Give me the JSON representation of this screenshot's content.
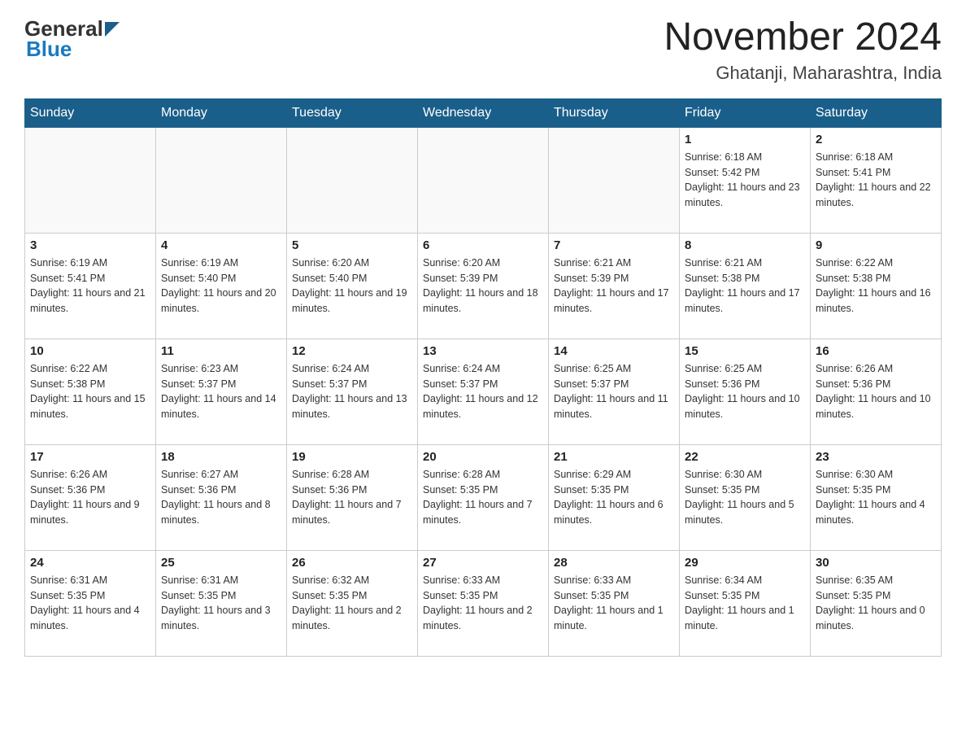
{
  "header": {
    "logo_general": "General",
    "logo_blue": "Blue",
    "month_title": "November 2024",
    "location": "Ghatanji, Maharashtra, India"
  },
  "days_of_week": [
    "Sunday",
    "Monday",
    "Tuesday",
    "Wednesday",
    "Thursday",
    "Friday",
    "Saturday"
  ],
  "weeks": [
    [
      {
        "day": "",
        "sunrise": "",
        "sunset": "",
        "daylight": ""
      },
      {
        "day": "",
        "sunrise": "",
        "sunset": "",
        "daylight": ""
      },
      {
        "day": "",
        "sunrise": "",
        "sunset": "",
        "daylight": ""
      },
      {
        "day": "",
        "sunrise": "",
        "sunset": "",
        "daylight": ""
      },
      {
        "day": "",
        "sunrise": "",
        "sunset": "",
        "daylight": ""
      },
      {
        "day": "1",
        "sunrise": "Sunrise: 6:18 AM",
        "sunset": "Sunset: 5:42 PM",
        "daylight": "Daylight: 11 hours and 23 minutes."
      },
      {
        "day": "2",
        "sunrise": "Sunrise: 6:18 AM",
        "sunset": "Sunset: 5:41 PM",
        "daylight": "Daylight: 11 hours and 22 minutes."
      }
    ],
    [
      {
        "day": "3",
        "sunrise": "Sunrise: 6:19 AM",
        "sunset": "Sunset: 5:41 PM",
        "daylight": "Daylight: 11 hours and 21 minutes."
      },
      {
        "day": "4",
        "sunrise": "Sunrise: 6:19 AM",
        "sunset": "Sunset: 5:40 PM",
        "daylight": "Daylight: 11 hours and 20 minutes."
      },
      {
        "day": "5",
        "sunrise": "Sunrise: 6:20 AM",
        "sunset": "Sunset: 5:40 PM",
        "daylight": "Daylight: 11 hours and 19 minutes."
      },
      {
        "day": "6",
        "sunrise": "Sunrise: 6:20 AM",
        "sunset": "Sunset: 5:39 PM",
        "daylight": "Daylight: 11 hours and 18 minutes."
      },
      {
        "day": "7",
        "sunrise": "Sunrise: 6:21 AM",
        "sunset": "Sunset: 5:39 PM",
        "daylight": "Daylight: 11 hours and 17 minutes."
      },
      {
        "day": "8",
        "sunrise": "Sunrise: 6:21 AM",
        "sunset": "Sunset: 5:38 PM",
        "daylight": "Daylight: 11 hours and 17 minutes."
      },
      {
        "day": "9",
        "sunrise": "Sunrise: 6:22 AM",
        "sunset": "Sunset: 5:38 PM",
        "daylight": "Daylight: 11 hours and 16 minutes."
      }
    ],
    [
      {
        "day": "10",
        "sunrise": "Sunrise: 6:22 AM",
        "sunset": "Sunset: 5:38 PM",
        "daylight": "Daylight: 11 hours and 15 minutes."
      },
      {
        "day": "11",
        "sunrise": "Sunrise: 6:23 AM",
        "sunset": "Sunset: 5:37 PM",
        "daylight": "Daylight: 11 hours and 14 minutes."
      },
      {
        "day": "12",
        "sunrise": "Sunrise: 6:24 AM",
        "sunset": "Sunset: 5:37 PM",
        "daylight": "Daylight: 11 hours and 13 minutes."
      },
      {
        "day": "13",
        "sunrise": "Sunrise: 6:24 AM",
        "sunset": "Sunset: 5:37 PM",
        "daylight": "Daylight: 11 hours and 12 minutes."
      },
      {
        "day": "14",
        "sunrise": "Sunrise: 6:25 AM",
        "sunset": "Sunset: 5:37 PM",
        "daylight": "Daylight: 11 hours and 11 minutes."
      },
      {
        "day": "15",
        "sunrise": "Sunrise: 6:25 AM",
        "sunset": "Sunset: 5:36 PM",
        "daylight": "Daylight: 11 hours and 10 minutes."
      },
      {
        "day": "16",
        "sunrise": "Sunrise: 6:26 AM",
        "sunset": "Sunset: 5:36 PM",
        "daylight": "Daylight: 11 hours and 10 minutes."
      }
    ],
    [
      {
        "day": "17",
        "sunrise": "Sunrise: 6:26 AM",
        "sunset": "Sunset: 5:36 PM",
        "daylight": "Daylight: 11 hours and 9 minutes."
      },
      {
        "day": "18",
        "sunrise": "Sunrise: 6:27 AM",
        "sunset": "Sunset: 5:36 PM",
        "daylight": "Daylight: 11 hours and 8 minutes."
      },
      {
        "day": "19",
        "sunrise": "Sunrise: 6:28 AM",
        "sunset": "Sunset: 5:36 PM",
        "daylight": "Daylight: 11 hours and 7 minutes."
      },
      {
        "day": "20",
        "sunrise": "Sunrise: 6:28 AM",
        "sunset": "Sunset: 5:35 PM",
        "daylight": "Daylight: 11 hours and 7 minutes."
      },
      {
        "day": "21",
        "sunrise": "Sunrise: 6:29 AM",
        "sunset": "Sunset: 5:35 PM",
        "daylight": "Daylight: 11 hours and 6 minutes."
      },
      {
        "day": "22",
        "sunrise": "Sunrise: 6:30 AM",
        "sunset": "Sunset: 5:35 PM",
        "daylight": "Daylight: 11 hours and 5 minutes."
      },
      {
        "day": "23",
        "sunrise": "Sunrise: 6:30 AM",
        "sunset": "Sunset: 5:35 PM",
        "daylight": "Daylight: 11 hours and 4 minutes."
      }
    ],
    [
      {
        "day": "24",
        "sunrise": "Sunrise: 6:31 AM",
        "sunset": "Sunset: 5:35 PM",
        "daylight": "Daylight: 11 hours and 4 minutes."
      },
      {
        "day": "25",
        "sunrise": "Sunrise: 6:31 AM",
        "sunset": "Sunset: 5:35 PM",
        "daylight": "Daylight: 11 hours and 3 minutes."
      },
      {
        "day": "26",
        "sunrise": "Sunrise: 6:32 AM",
        "sunset": "Sunset: 5:35 PM",
        "daylight": "Daylight: 11 hours and 2 minutes."
      },
      {
        "day": "27",
        "sunrise": "Sunrise: 6:33 AM",
        "sunset": "Sunset: 5:35 PM",
        "daylight": "Daylight: 11 hours and 2 minutes."
      },
      {
        "day": "28",
        "sunrise": "Sunrise: 6:33 AM",
        "sunset": "Sunset: 5:35 PM",
        "daylight": "Daylight: 11 hours and 1 minute."
      },
      {
        "day": "29",
        "sunrise": "Sunrise: 6:34 AM",
        "sunset": "Sunset: 5:35 PM",
        "daylight": "Daylight: 11 hours and 1 minute."
      },
      {
        "day": "30",
        "sunrise": "Sunrise: 6:35 AM",
        "sunset": "Sunset: 5:35 PM",
        "daylight": "Daylight: 11 hours and 0 minutes."
      }
    ]
  ]
}
